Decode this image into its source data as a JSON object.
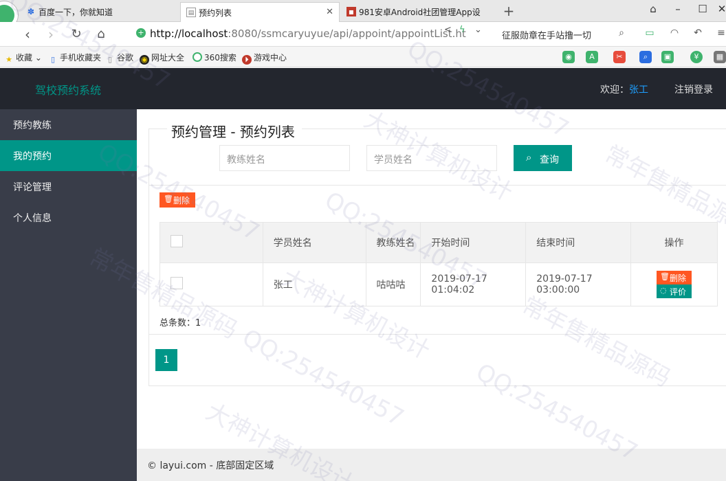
{
  "browser": {
    "tabs": [
      {
        "title": "百度一下，你就知道"
      },
      {
        "title": "预约列表"
      },
      {
        "title": "981安卓Android社团管理App设"
      }
    ],
    "new_tab": "+",
    "url_host": "http://localhost",
    "url_rest": ":8080/ssmcaryuyue/api/appoint/appointList.ht",
    "news": "征服勋章在手站撸一切",
    "bookmarks": [
      "收藏",
      "手机收藏夹",
      "谷歌",
      "网址大全",
      "360搜索",
      "游戏中心"
    ]
  },
  "header": {
    "logo": "驾校预约系统",
    "welcome_prefix": "欢迎：",
    "username": "张工",
    "logout": "注销登录"
  },
  "sidebar": {
    "items": [
      {
        "label": "预约教练"
      },
      {
        "label": "我的预约"
      },
      {
        "label": "评论管理"
      },
      {
        "label": "个人信息"
      }
    ],
    "active_index": 1
  },
  "main": {
    "title": "预约管理 - 预约列表",
    "search": {
      "coach_placeholder": "教练姓名",
      "student_placeholder": "学员姓名",
      "button_label": "查询"
    },
    "delete_button": "删除",
    "table": {
      "headers": [
        "学员姓名",
        "教练姓名",
        "开始时间",
        "结束时间",
        "操作"
      ],
      "rows": [
        {
          "student": "张工",
          "coach": "咕咕咕",
          "start": "2019-07-17 01:04:02",
          "end": "2019-07-17 03:00:00",
          "actions": [
            "删除",
            "评价"
          ]
        }
      ]
    },
    "total_label": "总条数：1",
    "page": "1"
  },
  "footer": {
    "text": "© layui.com - 底部固定区域"
  },
  "watermarks": [
    "QQ:254540457",
    "大神计算机设计",
    "常年售精品源码"
  ],
  "colors": {
    "accent": "#009688",
    "danger": "#ff5722",
    "header_bg": "#23262e",
    "sidebar_bg": "#393d49",
    "link": "#1e9fff"
  }
}
